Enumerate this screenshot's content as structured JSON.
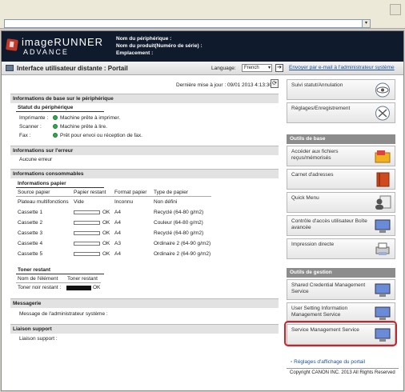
{
  "browser": {
    "address": ""
  },
  "header": {
    "logo_main": "imageRUNNER",
    "logo_sub": "ADVANCE",
    "device_name_label": "Nom du périphérique :",
    "product_name_label": "Nom du produit(Numéro de série) :",
    "location_label": "Emplacement :"
  },
  "subheader": {
    "title": "Interface utilisateur distante : Portail",
    "language_label": "Language:",
    "language_value": "French",
    "mail_link": "Envoyer par e-mail à l'administrateur système"
  },
  "refresh": {
    "text": "Dernière mise à jour : 09/01 2013 4:13:30"
  },
  "basic_info": {
    "section_title": "Informations de base sur le périphérique",
    "status_title": "Statut du périphérique",
    "rows": [
      {
        "label": "Imprimante :",
        "value": "Machine prête à imprimer."
      },
      {
        "label": "Scanner :",
        "value": "Machine prête à lire."
      },
      {
        "label": "Fax :",
        "value": "Prêt pour envoi ou réception de fax."
      }
    ]
  },
  "error_info": {
    "section_title": "Informations sur l'erreur",
    "value": "Aucune erreur"
  },
  "consumables": {
    "section_title": "Informations consommables",
    "paper_title": "Informations papier",
    "columns": [
      "Source papier",
      "Papier restant",
      "Format papier",
      "Type de papier"
    ],
    "rows": [
      {
        "source": "Plateau multifonctions",
        "remaining": "Vide",
        "size": "Inconnu",
        "type": "Non défini"
      },
      {
        "source": "Cassette 1",
        "remaining": "OK",
        "size": "A4",
        "type": "Recyclé (64-80 g/m2)"
      },
      {
        "source": "Cassette 2",
        "remaining": "OK",
        "size": "A4",
        "type": "Couleur (64-80 g/m2)"
      },
      {
        "source": "Cassette 3",
        "remaining": "OK",
        "size": "A4",
        "type": "Recyclé (64-80 g/m2)"
      },
      {
        "source": "Cassette 4",
        "remaining": "OK",
        "size": "A3",
        "type": "Ordinaire 2 (64-90 g/m2)"
      },
      {
        "source": "Cassette 5",
        "remaining": "OK",
        "size": "A4",
        "type": "Ordinaire 2 (64-90 g/m2)"
      }
    ],
    "toner_title": "Toner restant",
    "toner_columns": [
      "Nom de l'élément",
      "Toner restant"
    ],
    "toner_row": {
      "name": "Toner noir restant :",
      "value": "OK"
    }
  },
  "messaging": {
    "section_title": "Messagerie",
    "label": "Message de l'administrateur système :"
  },
  "support": {
    "section_title": "Liaison support",
    "label": "Liaison support :"
  },
  "sidebar": {
    "top_buttons": [
      "Suivi statut/Annulation",
      "Réglages/Enregistrement"
    ],
    "basic_tools_title": "Outils de base",
    "basic_tools": [
      "Accéder aux fichiers reçus/mémorisés",
      "Carnet d'adresses",
      "Quick Menu",
      "Contrôle d'accès utilisateur Boîte avancée",
      "Impression directe"
    ],
    "mgmt_tools_title": "Outils de gestion",
    "mgmt_tools": [
      "Shared Credential Management Service",
      "User Setting Information Management Service",
      "Service Management Service"
    ],
    "footer_link": "Réglages d'affichage du portail",
    "copyright": "Copyright CANON INC. 2013 All Rights Reserved"
  }
}
